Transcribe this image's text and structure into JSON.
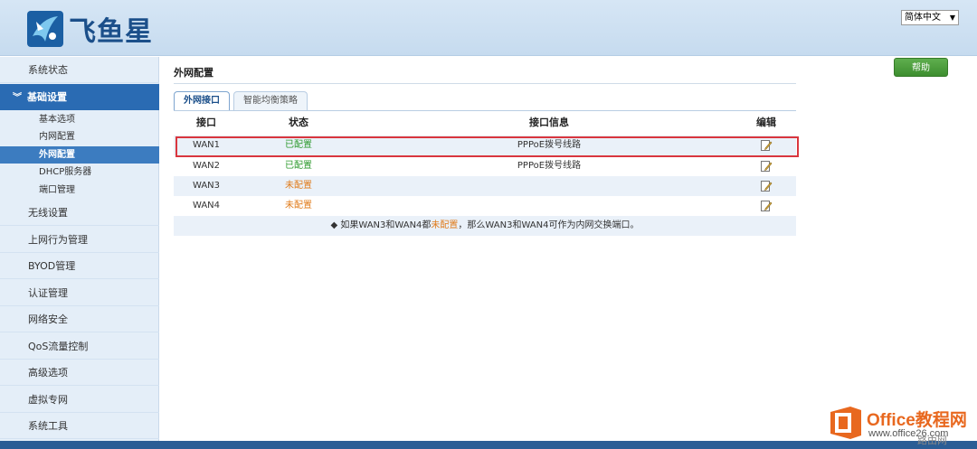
{
  "header": {
    "brand": "飞鱼星",
    "language": "简体中文"
  },
  "sidebar": {
    "items": [
      {
        "label": "系统状态"
      },
      {
        "label": "基础设置"
      },
      {
        "label": "无线设置"
      },
      {
        "label": "上网行为管理"
      },
      {
        "label": "BYOD管理"
      },
      {
        "label": "认证管理"
      },
      {
        "label": "网络安全"
      },
      {
        "label": "QoS流量控制"
      },
      {
        "label": "高级选项"
      },
      {
        "label": "虚拟专网"
      },
      {
        "label": "系统工具"
      }
    ],
    "subitems": [
      {
        "label": "基本选项"
      },
      {
        "label": "内网配置"
      },
      {
        "label": "外网配置"
      },
      {
        "label": "DHCP服务器"
      },
      {
        "label": "端口管理"
      }
    ]
  },
  "main": {
    "title": "外网配置",
    "help_label": "帮助",
    "tabs": [
      {
        "label": "外网接口"
      },
      {
        "label": "智能均衡策略"
      }
    ],
    "columns": [
      "接口",
      "状态",
      "接口信息",
      "编辑"
    ],
    "rows": [
      {
        "iface": "WAN1",
        "status": "已配置",
        "info": "PPPoE拨号线路"
      },
      {
        "iface": "WAN2",
        "status": "已配置",
        "info": "PPPoE拨号线路"
      },
      {
        "iface": "WAN3",
        "status": "未配置",
        "info": ""
      },
      {
        "iface": "WAN4",
        "status": "未配置",
        "info": ""
      }
    ],
    "note_prefix": "◆ 如果WAN3和WAN4都",
    "note_status": "未配置",
    "note_suffix": "，那么WAN3和WAN4可作为内网交换端口。"
  },
  "watermark": {
    "title": "Office教程网",
    "url": "www.office26.com",
    "tag": "路由网"
  },
  "colors": {
    "accent": "#2a6bb3",
    "configured": "#2e9a2e",
    "unconfigured": "#e07b1a",
    "highlight": "#d9363e",
    "help": "#4a9e3a"
  }
}
